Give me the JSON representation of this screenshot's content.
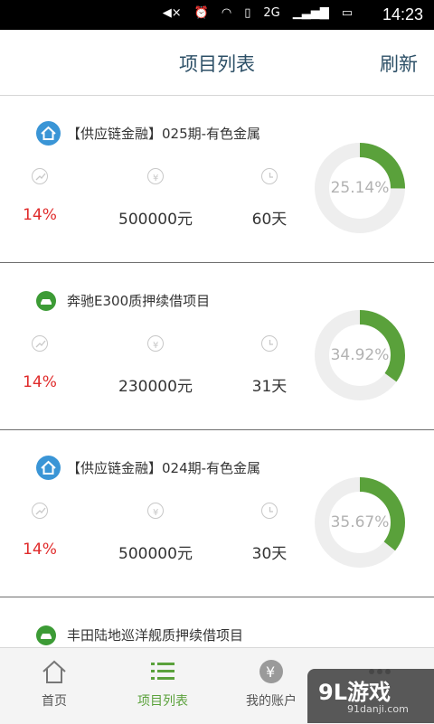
{
  "status_bar": {
    "time": "14:23",
    "network": "2G"
  },
  "header": {
    "title": "项目列表",
    "refresh_label": "刷新"
  },
  "projects": [
    {
      "name": "【供应链金融】025期-有色金属",
      "type_icon": "house-icon",
      "rate": "14%",
      "amount": "500000元",
      "days": "60天",
      "progress_label": "25.14%",
      "progress": 25.14
    },
    {
      "name": "奔驰E300质押续借项目",
      "type_icon": "car-icon",
      "rate": "14%",
      "amount": "230000元",
      "days": "31天",
      "progress_label": "34.92%",
      "progress": 34.92
    },
    {
      "name": "【供应链金融】024期-有色金属",
      "type_icon": "house-icon",
      "rate": "14%",
      "amount": "500000元",
      "days": "30天",
      "progress_label": "35.67%",
      "progress": 35.67
    },
    {
      "name": "丰田陆地巡洋舰质押续借项目",
      "type_icon": "car-icon"
    }
  ],
  "tabs": [
    {
      "label": "首页",
      "icon": "home-icon"
    },
    {
      "label": "项目列表",
      "icon": "list-icon",
      "active": true
    },
    {
      "label": "我的账户",
      "icon": "account-icon"
    },
    {
      "label": "",
      "icon": "more-icon"
    }
  ],
  "watermark": {
    "brand": "9L游戏",
    "site": "91danji.com"
  },
  "colors": {
    "accent": "#5aa13b",
    "rate_red": "#e02b2b",
    "title_blue": "#2d5067",
    "house_icon": "#3a95d6",
    "car_icon": "#3c9b35",
    "ring_track": "#eeeeee"
  }
}
